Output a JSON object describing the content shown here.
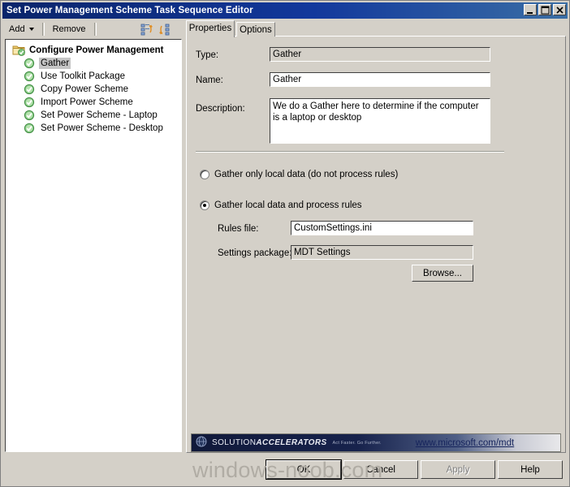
{
  "window": {
    "title": "Set Power Management Scheme Task Sequence Editor",
    "controls": {
      "minimize": "minimize-button",
      "maximize": "maximize-button",
      "close": "close-button"
    }
  },
  "toolbar": {
    "add_label": "Add",
    "remove_label": "Remove",
    "icon1": "move-up-icon",
    "icon2": "move-down-icon"
  },
  "tree": {
    "group": {
      "label": "Configure Power Management",
      "icon": "folder-check-icon"
    },
    "items": [
      {
        "label": "Gather",
        "icon": "green-check-icon",
        "selected": true
      },
      {
        "label": "Use Toolkit Package",
        "icon": "green-check-icon",
        "selected": false
      },
      {
        "label": "Copy Power Scheme",
        "icon": "green-check-icon",
        "selected": false
      },
      {
        "label": "Import Power Scheme",
        "icon": "green-check-icon",
        "selected": false
      },
      {
        "label": "Set Power Scheme - Laptop",
        "icon": "green-check-icon",
        "selected": false
      },
      {
        "label": "Set Power Scheme - Desktop",
        "icon": "green-check-icon",
        "selected": false
      }
    ]
  },
  "tabs": [
    {
      "label": "Properties",
      "active": true
    },
    {
      "label": "Options",
      "active": false
    }
  ],
  "properties": {
    "type_label": "Type:",
    "type_value": "Gather",
    "name_label": "Name:",
    "name_value": "Gather",
    "description_label": "Description:",
    "description_value": "We do a Gather here to determine if the computer is a laptop or desktop",
    "radio_local_only": "Gather only local data (do not process rules)",
    "radio_local_and_rules": "Gather local data and process rules",
    "rules_file_label": "Rules file:",
    "rules_file_value": "CustomSettings.ini",
    "settings_package_label": "Settings package:",
    "settings_package_value": "MDT Settings",
    "browse_label": "Browse..."
  },
  "banner": {
    "brand_prefix": "SOLUTION",
    "brand_suffix": "ACCELERATORS",
    "tagline": "Act Faster. Go Further.",
    "link": "www.microsoft.com/mdt",
    "globe_icon": "globe-icon"
  },
  "buttons": {
    "ok": "OK",
    "cancel": "Cancel",
    "apply": "Apply",
    "help": "Help"
  },
  "watermark": {
    "text": "windows-noob.com"
  },
  "colors": {
    "title_bar": "#0a246a",
    "face": "#d4d0c8",
    "selection": "#c5c5c5",
    "link": "#16245c",
    "check_green": "#3a9e3a"
  }
}
